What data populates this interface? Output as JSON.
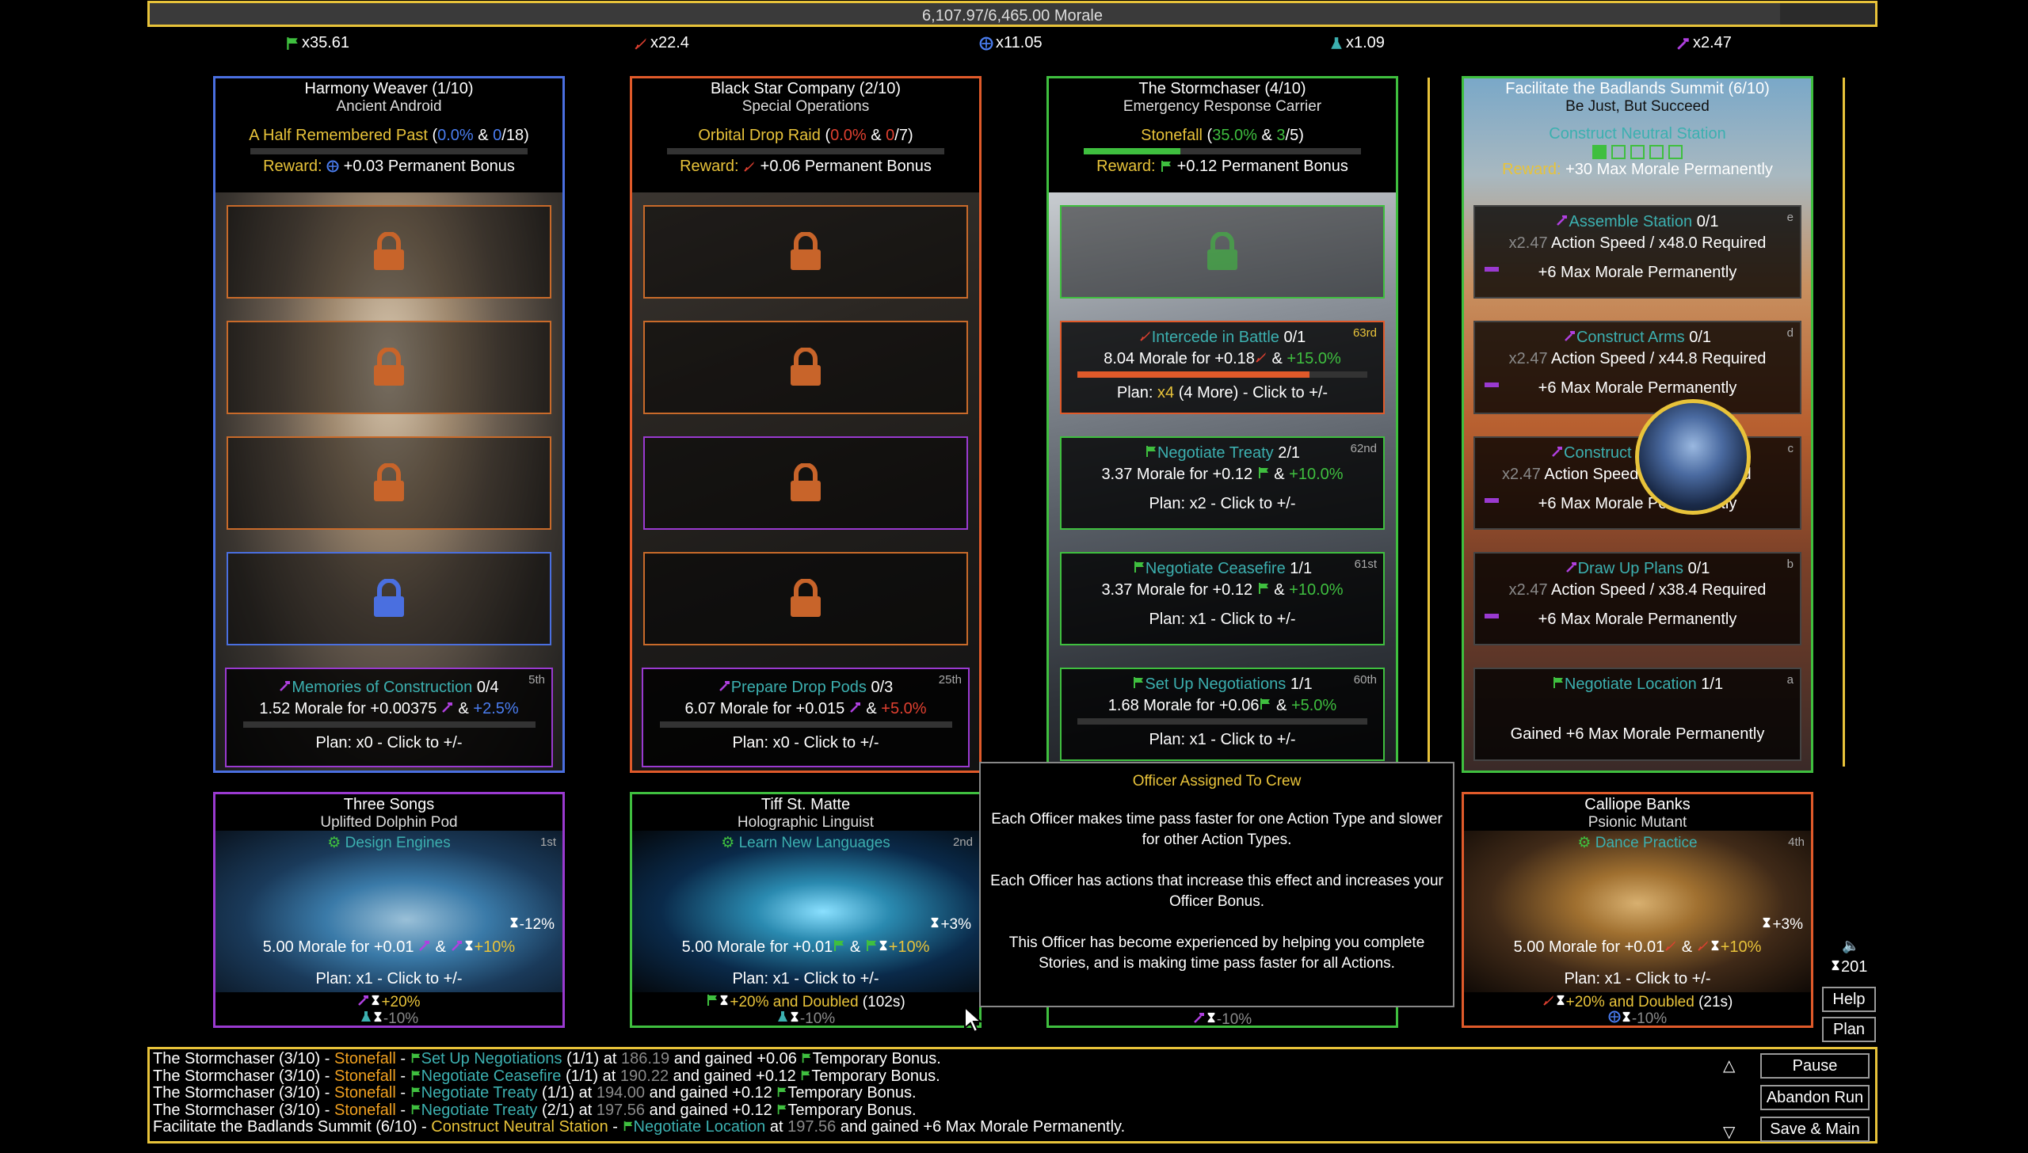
{
  "morale": {
    "text": "6,107.97/6,465.00 Morale",
    "fraction": 0.9447
  },
  "multipliers": [
    {
      "icon": "flag-icon",
      "color": "#3fbf3f",
      "value": "x35.61"
    },
    {
      "icon": "rocket-icon",
      "color": "#e04030",
      "value": "x22.4"
    },
    {
      "icon": "compass-icon",
      "color": "#4a7df0",
      "value": "x11.05"
    },
    {
      "icon": "flask-icon",
      "color": "#3cb0b0",
      "value": "x1.09"
    },
    {
      "icon": "hammer-icon",
      "color": "#b040e0",
      "value": "x2.47"
    }
  ],
  "crew_top": [
    {
      "title": "Harmony Weaver (1/10)",
      "subtitle": "Ancient Android",
      "story": "A Half Remembered Past",
      "story_pct": "0.0%",
      "story_amp": "&",
      "story_count": "0",
      "story_total": "/18)",
      "reward_label": "Reward:",
      "reward_text": "+0.03 Permanent Bonus",
      "action": {
        "name": "Memories of Construction",
        "count": "0/4",
        "rank": "5th",
        "line_a": "1.52 Morale for +0.00375",
        "line_amp": "&",
        "line_pct": "+2.5%",
        "plan": "Plan: x0 - Click to +/-"
      }
    },
    {
      "title": "Black Star Company (2/10)",
      "subtitle": "Special Operations",
      "story": "Orbital Drop Raid",
      "story_pct": "0.0%",
      "story_amp": "&",
      "story_count": "0",
      "story_total": "/7)",
      "reward_label": "Reward:",
      "reward_text": "+0.06 Permanent Bonus",
      "action": {
        "name": "Prepare Drop Pods",
        "count": "0/3",
        "rank": "25th",
        "line_a": "6.07 Morale for +0.015",
        "line_amp": "&",
        "line_pct": "+5.0%",
        "plan": "Plan: x0 - Click to +/-"
      }
    },
    {
      "title": "The Stormchaser (4/10)",
      "subtitle": "Emergency Response Carrier",
      "story": "Stonefall",
      "story_pct": "35.0%",
      "story_amp": "&",
      "story_count": "3",
      "story_total": "/5)",
      "reward_label": "Reward:",
      "reward_text": "+0.12 Permanent Bonus",
      "story_progress": 0.35,
      "actions": [
        {
          "name": "Intercede in Battle",
          "count": "0/1",
          "rank": "63rd",
          "line_a": "8.04 Morale for +0.18",
          "line_amp": "&",
          "line_pct": "+15.0%",
          "plan_pre": "Plan:",
          "plan_x": "x4",
          "plan_post": "(4 More) - Click to +/-",
          "progress": 0.8
        },
        {
          "name": "Negotiate Treaty",
          "count": "2/1",
          "rank": "62nd",
          "line_a": "3.37 Morale for +0.12",
          "line_amp": "&",
          "line_pct": "+10.0%",
          "plan": "Plan: x2 - Click to +/-"
        },
        {
          "name": "Negotiate Ceasefire",
          "count": "1/1",
          "rank": "61st",
          "line_a": "3.37 Morale for +0.12",
          "line_amp": "&",
          "line_pct": "+10.0%",
          "plan": "Plan: x1 - Click to +/-"
        },
        {
          "name": "Set Up Negotiations",
          "count": "1/1",
          "rank": "60th",
          "line_a": "1.68 Morale for +0.06",
          "line_amp": "&",
          "line_pct": "+5.0%",
          "plan": "Plan: x1 - Click to +/-"
        }
      ]
    },
    {
      "title": "Facilitate the Badlands Summit (6/10)",
      "subtitle": "Be Just, But Succeed",
      "story": "Construct Neutral Station",
      "reward_label": "Reward:",
      "reward_text": "+30 Max Morale Permanently",
      "actions": [
        {
          "name": "Assemble Station",
          "count": "0/1",
          "rank": "e",
          "line_mult": "x2.47",
          "line_a": "Action Speed / x48.0 Required",
          "line_b": "+6 Max Morale Permanently"
        },
        {
          "name": "Construct Arms",
          "count": "0/1",
          "rank": "d",
          "line_mult": "x2.47",
          "line_a": "Action Speed / x44.8 Required",
          "line_b": "+6 Max Morale Permanently"
        },
        {
          "name": "Construct",
          "count": "",
          "rank": "c",
          "line_mult": "x2.47",
          "line_a": "Action Speed",
          "line_a2": "ed",
          "line_b": "+6 Max Morale Permanently"
        },
        {
          "name": "Draw Up Plans",
          "count": "0/1",
          "rank": "b",
          "line_mult": "x2.47",
          "line_a": "Action Speed / x38.4 Required",
          "line_b": "+6 Max Morale Permanently"
        },
        {
          "name": "Negotiate Location",
          "count": "1/1",
          "rank": "a",
          "line_b": "Gained +6 Max Morale Permanently"
        }
      ]
    }
  ],
  "officers": [
    {
      "title": "Three Songs",
      "subtitle": "Uplifted Dolphin Pod",
      "action": "Design Engines",
      "rank": "1st",
      "bonus": "-12%",
      "line_a": "5.00 Morale for +0.01",
      "line_amp": "&",
      "line_pct": "+10%",
      "plan": "Plan: x1 - Click to +/-",
      "foot1": "+20%",
      "foot2": "-10%"
    },
    {
      "title": "Tiff St. Matte",
      "subtitle": "Holographic Linguist",
      "action": "Learn New Languages",
      "rank": "2nd",
      "bonus": "+3%",
      "line_a": "5.00 Morale for +0.01",
      "line_amp": "&",
      "line_pct": "+10%",
      "plan": "Plan: x1 - Click to +/-",
      "foot1": "+20% and",
      "foot1b": "Doubled",
      "foot1c": "(102s)",
      "foot2": "-10%"
    },
    {
      "foot2": "-10%"
    },
    {
      "title": "Calliope Banks",
      "subtitle": "Psionic Mutant",
      "action": "Dance Practice",
      "rank": "4th",
      "bonus": "+3%",
      "line_a": "5.00 Morale for +0.01",
      "line_amp": "&",
      "line_pct": "+10%",
      "plan": "Plan: x1 - Click to +/-",
      "foot1": "+20% and",
      "foot1b": "Doubled",
      "foot1c": "(21s)",
      "foot2": "-10%"
    }
  ],
  "tooltip": {
    "title": "Officer Assigned To Crew",
    "p1": "Each Officer makes time pass faster for one Action Type and slower for other Action Types.",
    "p2": "Each Officer has actions that increase this effect and increases your Officer Bonus.",
    "p3": "This Officer has become experienced by helping you complete Stories, and is making time pass faster for all Actions."
  },
  "side": {
    "time": "201",
    "help": "Help",
    "plan": "Plan",
    "pause": "Pause",
    "abandon": "Abandon Run",
    "save": "Save & Main"
  },
  "log": [
    {
      "a": "The Stormchaser (3/10) -",
      "b": "Stonefall",
      "c": "-",
      "d": "Set Up Negotiations",
      "e": "(1/1) at",
      "f": "186.19",
      "g": "and gained +0.06",
      "h": "Temporary Bonus."
    },
    {
      "a": "The Stormchaser (3/10) -",
      "b": "Stonefall",
      "c": "-",
      "d": "Negotiate Ceasefire",
      "e": "(1/1) at",
      "f": "190.22",
      "g": "and gained +0.12",
      "h": "Temporary Bonus."
    },
    {
      "a": "The Stormchaser (3/10) -",
      "b": "Stonefall",
      "c": "-",
      "d": "Negotiate Treaty",
      "e": "(1/1) at",
      "f": "194.00",
      "g": "and gained +0.12",
      "h": "Temporary Bonus."
    },
    {
      "a": "The Stormchaser (3/10) -",
      "b": "Stonefall",
      "c": "-",
      "d": "Negotiate Treaty",
      "e": "(2/1) at",
      "f": "197.56",
      "g": "and gained +0.12",
      "h": "Temporary Bonus."
    },
    {
      "a": "Facilitate the Badlands Summit (6/10) -",
      "b": "Construct Neutral Station",
      "c": "-",
      "d": "Negotiate Location",
      "e": "at",
      "f": "197.56",
      "g": "and gained +6 Max Morale Permanently.",
      "h": ""
    }
  ]
}
